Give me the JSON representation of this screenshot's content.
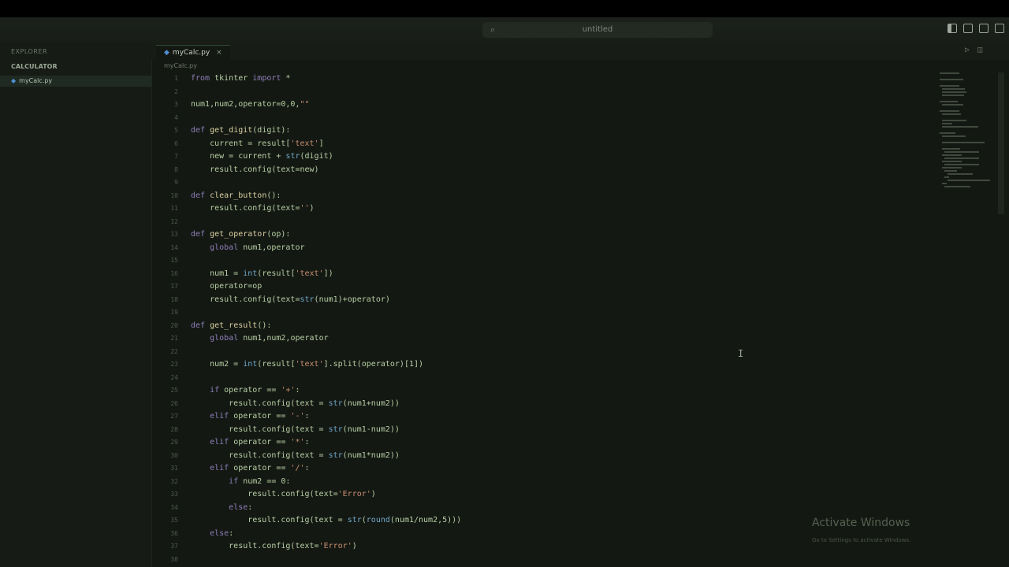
{
  "titlebar": {
    "search_text": "untitled"
  },
  "sidebar": {
    "title": "EXPLORER",
    "folder": "CALCULATOR",
    "file": "myCalc.py"
  },
  "tab": {
    "label": "myCalc.py",
    "close": "×"
  },
  "breadcrumb": "myCalc.py",
  "editor_lines": [
    {
      "n": "1",
      "t": "from tkinter import *"
    },
    {
      "n": "2",
      "t": ""
    },
    {
      "n": "3",
      "t": "num1,num2,operator=0,0,\"\""
    },
    {
      "n": "4",
      "t": ""
    },
    {
      "n": "5",
      "t": "def get_digit(digit):"
    },
    {
      "n": "6",
      "t": "    current = result['text']"
    },
    {
      "n": "7",
      "t": "    new = current + str(digit)"
    },
    {
      "n": "8",
      "t": "    result.config(text=new)"
    },
    {
      "n": "9",
      "t": ""
    },
    {
      "n": "10",
      "t": "def clear_button():"
    },
    {
      "n": "11",
      "t": "    result.config(text='')"
    },
    {
      "n": "12",
      "t": ""
    },
    {
      "n": "13",
      "t": "def get_operator(op):"
    },
    {
      "n": "14",
      "t": "    global num1,operator"
    },
    {
      "n": "15",
      "t": ""
    },
    {
      "n": "16",
      "t": "    num1 = int(result['text'])"
    },
    {
      "n": "17",
      "t": "    operator=op"
    },
    {
      "n": "18",
      "t": "    result.config(text=str(num1)+operator)"
    },
    {
      "n": "19",
      "t": ""
    },
    {
      "n": "20",
      "t": "def get_result():"
    },
    {
      "n": "21",
      "t": "    global num1,num2,operator"
    },
    {
      "n": "22",
      "t": ""
    },
    {
      "n": "23",
      "t": "    num2 = int(result['text'].split(operator)[1])"
    },
    {
      "n": "24",
      "t": ""
    },
    {
      "n": "25",
      "t": "    if operator == '+':"
    },
    {
      "n": "26",
      "t": "        result.config(text = str(num1+num2))"
    },
    {
      "n": "27",
      "t": "    elif operator == '-':"
    },
    {
      "n": "28",
      "t": "        result.config(text = str(num1-num2))"
    },
    {
      "n": "29",
      "t": "    elif operator == '*':"
    },
    {
      "n": "30",
      "t": "        result.config(text = str(num1*num2))"
    },
    {
      "n": "31",
      "t": "    elif operator == '/':"
    },
    {
      "n": "32",
      "t": "        if num2 == 0:"
    },
    {
      "n": "33",
      "t": "            result.config(text='Error')"
    },
    {
      "n": "34",
      "t": "        else:"
    },
    {
      "n": "35",
      "t": "            result.config(text = str(round(num1/num2,5)))"
    },
    {
      "n": "36",
      "t": "    else:"
    },
    {
      "n": "37",
      "t": "        result.config(text='Error')"
    },
    {
      "n": "38",
      "t": ""
    }
  ],
  "watermark": {
    "title": "Activate Windows",
    "subtitle": "Go to Settings to activate Windows."
  }
}
